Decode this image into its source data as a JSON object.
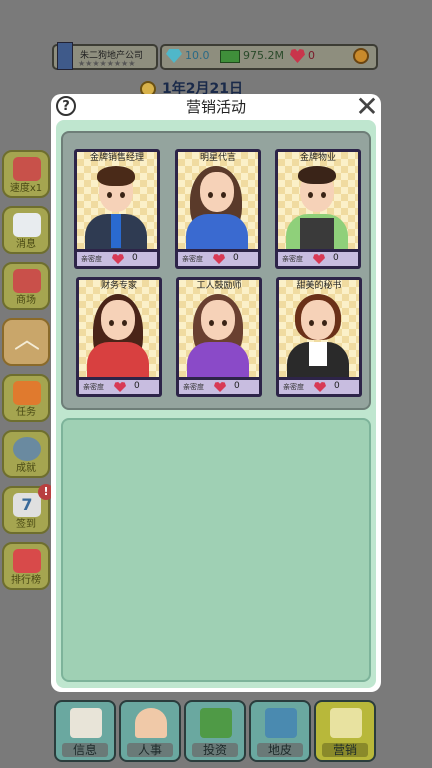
{
  "header": {
    "company_name": "朱二狗地产公司",
    "stars": "★★★★★★★★",
    "gems": "10.0",
    "cash": "975.2M",
    "hearts": "0",
    "date": "1年2月21日"
  },
  "sidebar": {
    "items": [
      {
        "label": "速度x1",
        "icon": "fire-truck-icon",
        "color": "#c8514a"
      },
      {
        "label": "消息",
        "icon": "message-icon",
        "color": "#e8ecef"
      },
      {
        "label": "商场",
        "icon": "shop-icon",
        "color": "#c9504a"
      },
      {
        "label": "",
        "icon": "chevron-up-icon",
        "color": "#d5c4a0"
      },
      {
        "label": "任务",
        "icon": "carrot-icon",
        "color": "#e07a2e"
      },
      {
        "label": "成就",
        "icon": "medal-icon",
        "color": "#6a8aa0"
      },
      {
        "label": "签到",
        "icon": "calendar-icon",
        "color": "#e0e0e0",
        "badge": "!"
      },
      {
        "label": "排行榜",
        "icon": "leaderboard-icon",
        "color": "#d84a4a"
      }
    ]
  },
  "modal": {
    "title": "营销活动",
    "help": "?",
    "close": "✕",
    "cards": [
      {
        "title": "金牌销售经理",
        "affinity_label": "亲密度",
        "affinity": "0"
      },
      {
        "title": "明星代言",
        "affinity_label": "亲密度",
        "affinity": "0"
      },
      {
        "title": "金牌物业",
        "affinity_label": "亲密度",
        "affinity": "0"
      },
      {
        "title": "财务专家",
        "affinity_label": "亲密度",
        "affinity": "0"
      },
      {
        "title": "工人鼓励师",
        "affinity_label": "亲密度",
        "affinity": "0"
      },
      {
        "title": "甜美的秘书",
        "affinity_label": "亲密度",
        "affinity": "0"
      }
    ]
  },
  "bottom_nav": {
    "items": [
      {
        "label": "信息",
        "icon": "clipboard-icon",
        "color": "#6aa8a0"
      },
      {
        "label": "人事",
        "icon": "person-icon",
        "color": "#6aa8a0"
      },
      {
        "label": "投资",
        "icon": "money-icon",
        "color": "#6aa8a0"
      },
      {
        "label": "地皮",
        "icon": "building-icon",
        "color": "#6aa8a0"
      },
      {
        "label": "营销",
        "icon": "shopping-bag-icon",
        "color": "#b8b83a"
      }
    ]
  }
}
